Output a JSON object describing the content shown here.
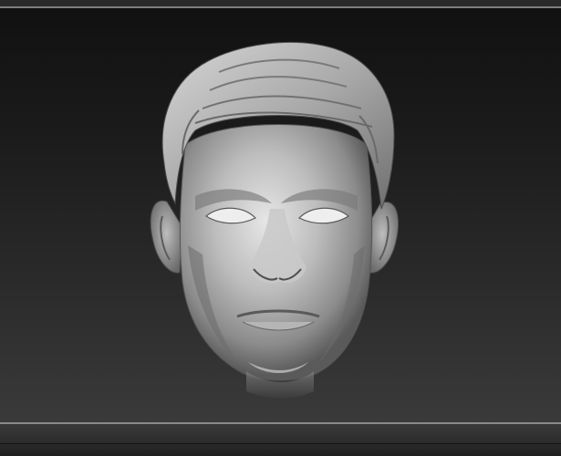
{
  "app": {
    "title": ""
  },
  "viewport": {
    "subject_icon": "sculpted-head-model-icon",
    "background_color_top": "#111111",
    "background_color_bottom": "#3a3a3a"
  },
  "colors": {
    "frame_line": "#7e7e7e",
    "panel": "#2f2f2f",
    "model_mid": "#9a9a9a",
    "model_highlight": "#e4e4e4",
    "model_shadow": "#3c3c3c"
  }
}
